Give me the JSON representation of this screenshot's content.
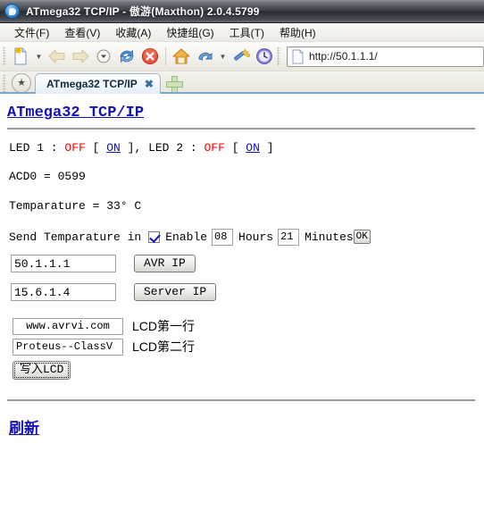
{
  "window": {
    "title": "ATmega32 TCP/IP - 傲游(Maxthon) 2.0.4.5799",
    "app_icon": "maxthon-logo-icon"
  },
  "menubar": {
    "items": [
      {
        "label": "文件(F)",
        "name": "menu-file"
      },
      {
        "label": "查看(V)",
        "name": "menu-view"
      },
      {
        "label": "收藏(A)",
        "name": "menu-favorites"
      },
      {
        "label": "快捷组(G)",
        "name": "menu-groups"
      },
      {
        "label": "工具(T)",
        "name": "menu-tools"
      },
      {
        "label": "帮助(H)",
        "name": "menu-help"
      }
    ]
  },
  "toolbar": {
    "icons": [
      "new-page-icon",
      "dropdown-caret-icon",
      "back-arrow-icon",
      "forward-arrow-icon",
      "history-dropdown-icon",
      "refresh-icon",
      "stop-icon",
      "home-icon",
      "undo-icon",
      "undo-dropdown-caret-icon",
      "magic-wand-icon",
      "clock-icon"
    ],
    "address": {
      "value": "http://50.1.1.1/",
      "icon": "page-icon"
    }
  },
  "tabbar": {
    "favorites_icon": "star-icon",
    "tabs": [
      {
        "label": "ATmega32 TCP/IP",
        "close": "✖",
        "active": true
      }
    ],
    "new_tab_icon": "plus-icon"
  },
  "page": {
    "heading": "ATmega32 TCP/IP",
    "led1": {
      "label": "LED 1 : ",
      "state": "OFF",
      "open_bracket": " [ ",
      "action": "ON",
      "close_bracket": " ], "
    },
    "led2": {
      "label": "LED 2 : ",
      "state": "OFF",
      "open_bracket": " [ ",
      "action": "ON",
      "close_bracket": " ]"
    },
    "adc": "ACD0 = 0599",
    "temperature": "Temparature = 33° C",
    "send_form": {
      "prefix": "Send Temparature in",
      "enable_label": "Enable",
      "checked": true,
      "hours_value": "08",
      "hours_label": "Hours",
      "minutes_value": "21",
      "minutes_label": "Minutes",
      "ok_label": "OK"
    },
    "avr_ip": {
      "value": "50.1.1.1",
      "button": "AVR IP"
    },
    "server_ip": {
      "value": "15.6.1.4",
      "button": "Server IP"
    },
    "lcd_line1": {
      "value": "www.avrvi.com",
      "caption": "LCD第一行"
    },
    "lcd_line2": {
      "value": "Proteus--ClassV",
      "caption": "LCD第二行"
    },
    "lcd_write_button": "写入LCD",
    "refresh_link": "刷新"
  },
  "colors": {
    "link": "#1212b7",
    "off_state": "#ff0000",
    "title_bar": "#3b3d45",
    "tab_underline": "#7ba7d7"
  }
}
